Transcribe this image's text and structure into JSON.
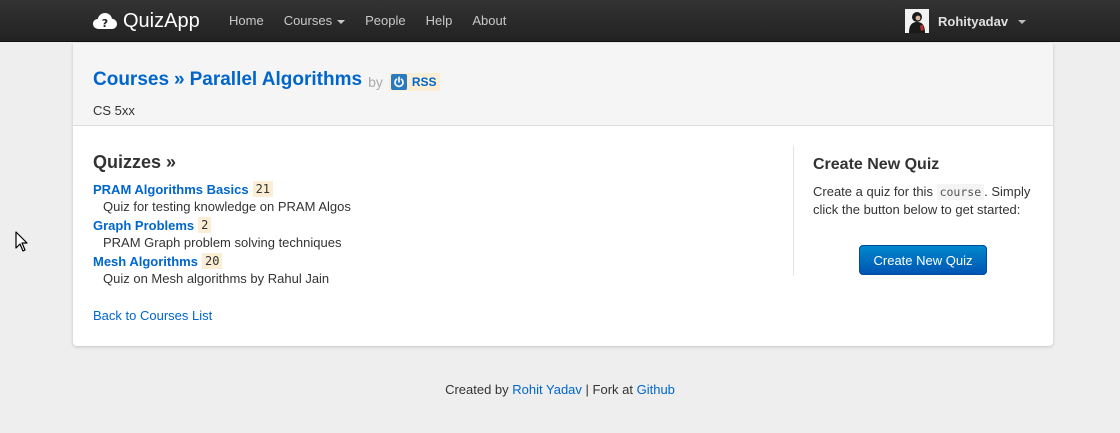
{
  "navbar": {
    "brand": "QuizApp",
    "items": [
      {
        "label": "Home"
      },
      {
        "label": "Courses"
      },
      {
        "label": "People"
      },
      {
        "label": "Help"
      },
      {
        "label": "About"
      }
    ],
    "user": "Rohityadav"
  },
  "hero": {
    "breadcrumb_root": "Courses",
    "separator": "»",
    "course_title": "Parallel Algorithms",
    "by": "by",
    "rss_label": "RSS",
    "subtitle": "CS 5xx"
  },
  "quizzes": {
    "heading": "Quizzes »",
    "items": [
      {
        "name": "PRAM Algorithms Basics",
        "count": "21",
        "description": "Quiz for testing knowledge on PRAM Algos"
      },
      {
        "name": "Graph Problems",
        "count": "2",
        "description": "PRAM Graph problem solving techniques"
      },
      {
        "name": "Mesh Algorithms",
        "count": "20",
        "description": "Quiz on Mesh algorithms by Rahul Jain"
      }
    ],
    "back_link": "Back to Courses List"
  },
  "sidebar": {
    "heading": "Create New Quiz",
    "text_before": "Create a quiz for this",
    "code": "course",
    "text_after": ". Simply click the button below to get started:",
    "button": "Create New Quiz"
  },
  "footer": {
    "created_by": "Created by",
    "author": "Rohit Yadav",
    "fork_text": "| Fork at",
    "github": "Github"
  },
  "colors": {
    "navbar": "#222222",
    "link": "#0066cc",
    "badge_bg": "#fbeed5",
    "button": "#0077cc",
    "page_bg": "#eeeeee"
  }
}
